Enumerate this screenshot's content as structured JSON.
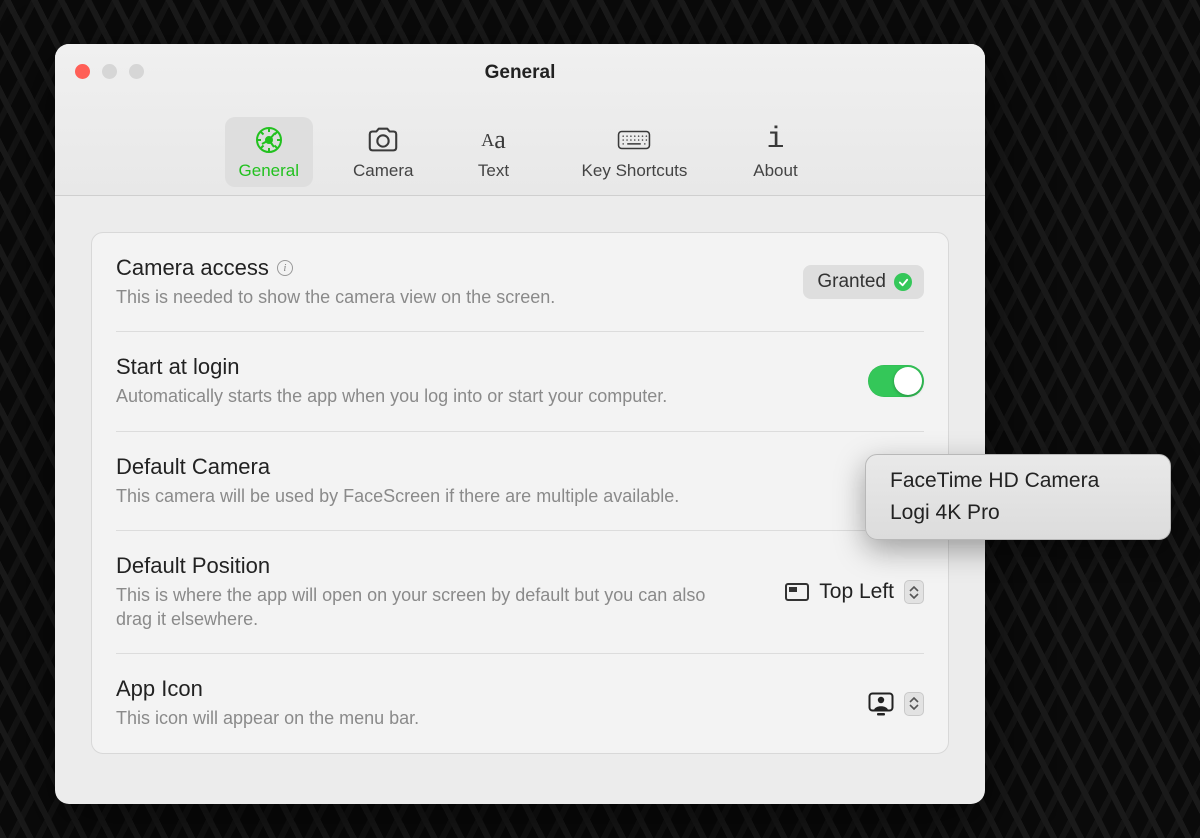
{
  "window": {
    "title": "General"
  },
  "toolbar": {
    "items": [
      {
        "id": "general",
        "label": "General",
        "selected": true
      },
      {
        "id": "camera",
        "label": "Camera",
        "selected": false
      },
      {
        "id": "text",
        "label": "Text",
        "selected": false
      },
      {
        "id": "key_shortcuts",
        "label": "Key Shortcuts",
        "selected": false
      },
      {
        "id": "about",
        "label": "About",
        "selected": false
      }
    ]
  },
  "settings": {
    "camera_access": {
      "title": "Camera access",
      "desc": "This is needed to show the camera view on the screen.",
      "status_label": "Granted",
      "granted": true
    },
    "start_at_login": {
      "title": "Start at login",
      "desc": "Automatically starts the app when you log into or start your computer.",
      "enabled": true
    },
    "default_camera": {
      "title": "Default Camera",
      "desc": "This camera will be used by FaceScreen if there are multiple available.",
      "options": [
        "FaceTime HD Camera",
        "Logi 4K Pro"
      ]
    },
    "default_position": {
      "title": "Default Position",
      "desc": "This is where the app will open on your screen by default but you can also drag it elsewhere.",
      "value": "Top Left"
    },
    "app_icon": {
      "title": "App Icon",
      "desc": "This icon will appear on the menu bar."
    }
  },
  "colors": {
    "accent_green": "#34c759",
    "accent_green_text": "#22c11f"
  }
}
